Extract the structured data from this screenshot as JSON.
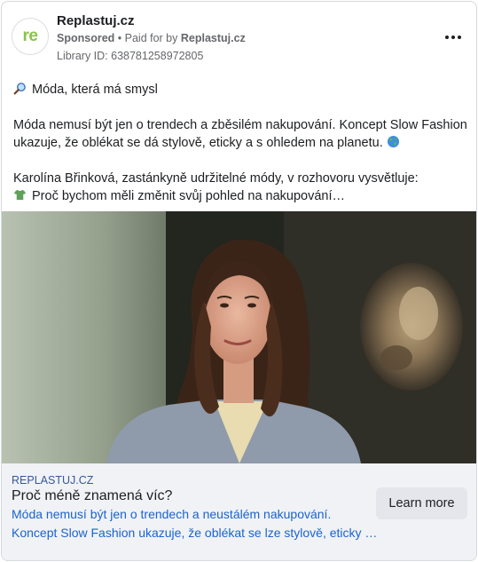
{
  "advertiser": {
    "avatar_text": "re",
    "name": "Replastuj.cz",
    "sponsored_label": "Sponsored",
    "separator": " • ",
    "paid_for_prefix": "Paid for by ",
    "paid_for_name": "Replastuj.cz",
    "library_id": "Library ID: 638781258972805"
  },
  "post": {
    "line1": "Móda, která má smysl",
    "line1_icon": "magnifying-glass-icon",
    "para2_line1": "Móda nemusí být jen o trendech a zběsilém nakupování. Koncept Slow Fashion",
    "para2_line2": "ukazuje, že oblékat se dá stylově, eticky a s ohledem na planetu.",
    "para2_icon": "globe-icon",
    "para3_line1": "Karolína Břinková, zastánkyně udržitelné módy, v rozhovoru vysvětluje:",
    "para3_line2": "Proč bychom měli změnit svůj pohled na nakupování…",
    "para3_icon": "tshirt-icon"
  },
  "link_card": {
    "domain": "REPLASTUJ.CZ",
    "headline": "Proč méně znamená víc?",
    "description_line1": "Móda nemusí být jen o trendech a neustálém nakupování.",
    "description_line2": "Koncept Slow Fashion ukazuje, že oblékat se lze stylově, eticky …",
    "cta_label": "Learn more"
  },
  "colors": {
    "brand_green": "#8bc34a",
    "link_blue": "#1a63d0",
    "footer_bg": "#f0f2f5"
  }
}
